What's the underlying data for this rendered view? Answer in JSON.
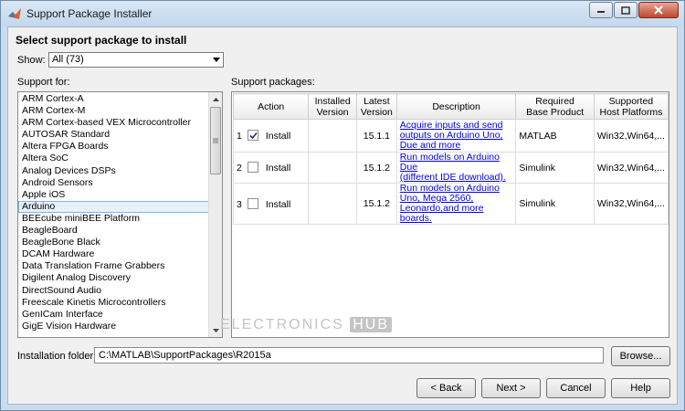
{
  "window": {
    "title": "Support Package Installer"
  },
  "heading": "Select support package to install",
  "show": {
    "label": "Show:",
    "selected": "All (73)"
  },
  "support_for": {
    "label": "Support for:",
    "selected": "Arduino",
    "items": [
      "ARM Cortex-A",
      "ARM Cortex-M",
      "ARM Cortex-based VEX Microcontroller",
      "AUTOSAR Standard",
      "Altera FPGA Boards",
      "Altera SoC",
      "Analog Devices DSPs",
      "Android Sensors",
      "Apple iOS",
      "Arduino",
      "BEEcube miniBEE Platform",
      "BeagleBoard",
      "BeagleBone Black",
      "DCAM Hardware",
      "Data Translation Frame Grabbers",
      "Digilent Analog Discovery",
      "DirectSound Audio",
      "Freescale Kinetis Microcontrollers",
      "GenICam Interface",
      "GigE Vision Hardware"
    ]
  },
  "packages": {
    "label": "Support packages:",
    "columns": {
      "action": "Action",
      "installed_1": "Installed",
      "installed_2": "Version",
      "latest_1": "Latest",
      "latest_2": "Version",
      "description": "Description",
      "required_1": "Required",
      "required_2": "Base Product",
      "platforms_1": "Supported",
      "platforms_2": "Host Platforms"
    },
    "rows": [
      {
        "num": "1",
        "checked": true,
        "action": "Install",
        "installed": "",
        "latest": "15.1.1",
        "desc_1": "Acquire inputs and send",
        "desc_2": "outputs on Arduino Uno,",
        "desc_3": "Due and more",
        "base": "MATLAB",
        "platforms": "Win32,Win64,..."
      },
      {
        "num": "2",
        "checked": false,
        "action": "Install",
        "installed": "",
        "latest": "15.1.2",
        "desc_1": "Run models on Arduino Due",
        "desc_2": "(different IDE download).",
        "desc_3": "",
        "base": "Simulink",
        "platforms": "Win32,Win64,..."
      },
      {
        "num": "3",
        "checked": false,
        "action": "Install",
        "installed": "",
        "latest": "15.1.2",
        "desc_1": "Run models on Arduino",
        "desc_2": "Uno, Mega 2560,",
        "desc_3": "Leonardo,and more boards.",
        "base": "Simulink",
        "platforms": "Win32,Win64,..."
      }
    ]
  },
  "watermark": {
    "left": "ELECTRONICS",
    "right": "HUB"
  },
  "folder": {
    "label": "Installation folder:",
    "value": "C:\\MATLAB\\SupportPackages\\R2015a"
  },
  "buttons": {
    "browse": "Browse...",
    "back": "< Back",
    "next": "Next >",
    "cancel": "Cancel",
    "help": "Help"
  }
}
